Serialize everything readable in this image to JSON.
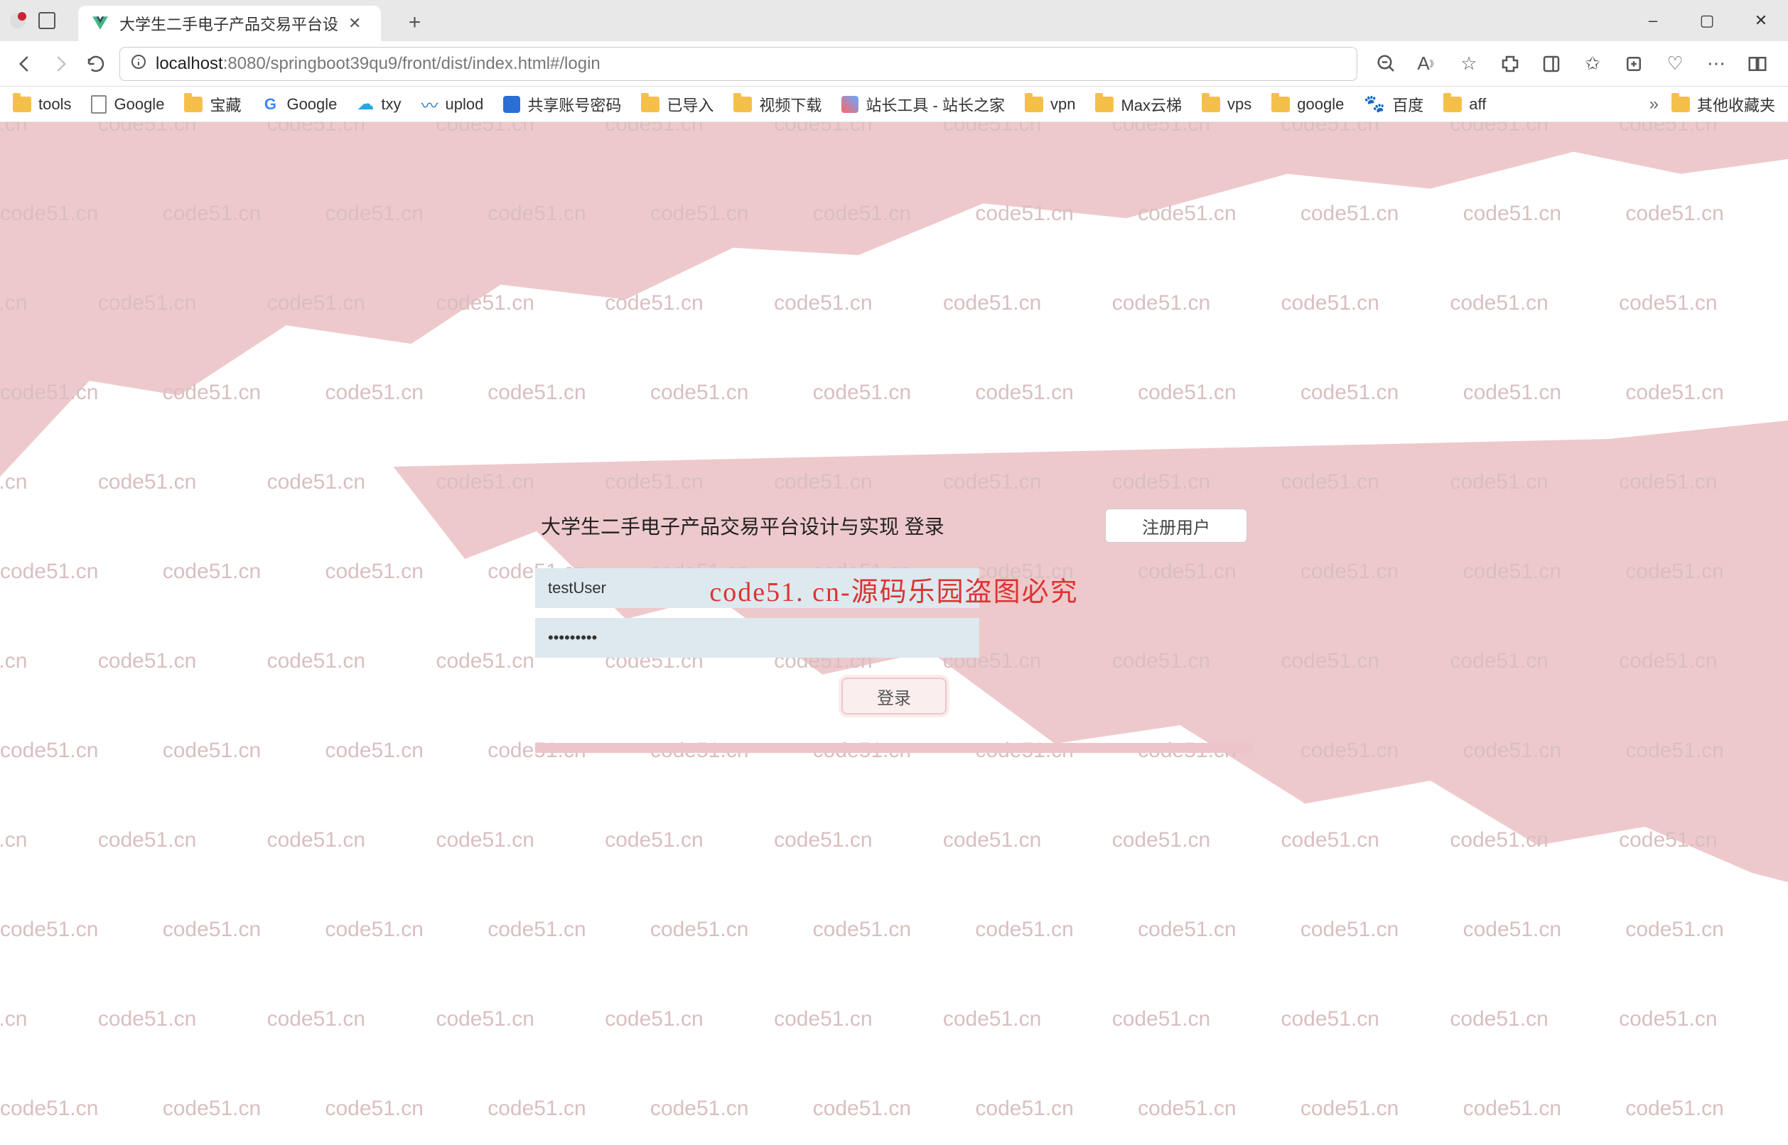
{
  "browser": {
    "tab_title": "大学生二手电子产品交易平台设",
    "url_host": "localhost",
    "url_port": ":8080",
    "url_path": "/springboot39qu9/front/dist/index.html#/login"
  },
  "bookmarks": {
    "items": [
      {
        "icon": "folder",
        "label": "tools"
      },
      {
        "icon": "page",
        "label": "Google"
      },
      {
        "icon": "folder",
        "label": "宝藏"
      },
      {
        "icon": "g",
        "label": "Google"
      },
      {
        "icon": "cloud",
        "label": "txy"
      },
      {
        "icon": "wave",
        "label": "uplod"
      },
      {
        "icon": "blue",
        "label": "共享账号密码"
      },
      {
        "icon": "folder",
        "label": "已导入"
      },
      {
        "icon": "folder",
        "label": "视频下载"
      },
      {
        "icon": "grid",
        "label": "站长工具 - 站长之家"
      },
      {
        "icon": "folder",
        "label": "vpn"
      },
      {
        "icon": "folder",
        "label": "Max云梯"
      },
      {
        "icon": "folder",
        "label": "vps"
      },
      {
        "icon": "folder",
        "label": "google"
      },
      {
        "icon": "paw",
        "label": "百度"
      },
      {
        "icon": "folder",
        "label": "aff"
      }
    ],
    "overflow_label": "其他收藏夹"
  },
  "login": {
    "title": "大学生二手电子产品交易平台设计与实现 登录",
    "register_label": "注册用户",
    "username_value": "testUser",
    "password_value": "•••••••••",
    "login_label": "登录"
  },
  "watermark": {
    "text": "code51.cn",
    "center_text": "code51. cn-源码乐园盗图必究"
  }
}
